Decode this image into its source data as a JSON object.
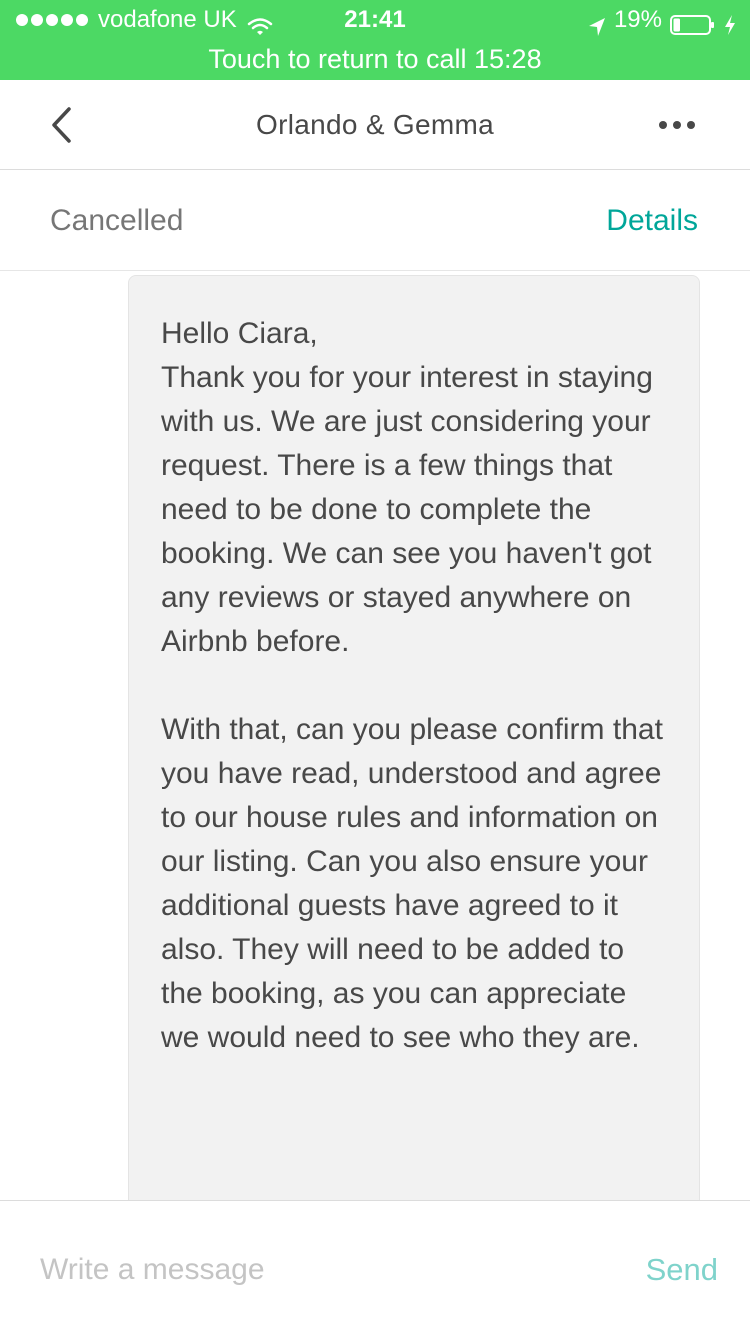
{
  "status_bar": {
    "carrier": "vodafone UK",
    "time": "21:41",
    "battery": "19%",
    "signal_bars": 5,
    "battery_level": 0.19,
    "icons": [
      "wifi-icon",
      "location-icon",
      "battery-icon",
      "charging-bolt-icon"
    ]
  },
  "call_banner": {
    "text": "Touch to return to call 15:28"
  },
  "nav": {
    "title": "Orlando & Gemma",
    "back_icon": "chevron-left-icon",
    "more_icon": "more-dots-icon"
  },
  "sub_header": {
    "status": "Cancelled",
    "details_label": "Details"
  },
  "message": {
    "paragraphs": [
      "Hello Ciara,\nThank you for your interest in staying with us. We are just considering your request. There is a few things that need to be done to complete the booking. We can see you haven't got any reviews or stayed anywhere on Airbnb before.",
      "With that, can you please confirm that you have read, understood and agree to our house rules and information on our listing. Can you also ensure your additional guests have agreed to it also. They will need to be added to the booking, as you can appreciate we would need to see who they are."
    ]
  },
  "composer": {
    "placeholder": "Write a message",
    "value": "",
    "send_label": "Send"
  },
  "colors": {
    "status_bar_bg": "#4cd964",
    "accent": "#00a699",
    "send_disabled": "#7fd3cb",
    "bubble_bg": "#f2f2f2",
    "text": "#484848"
  }
}
